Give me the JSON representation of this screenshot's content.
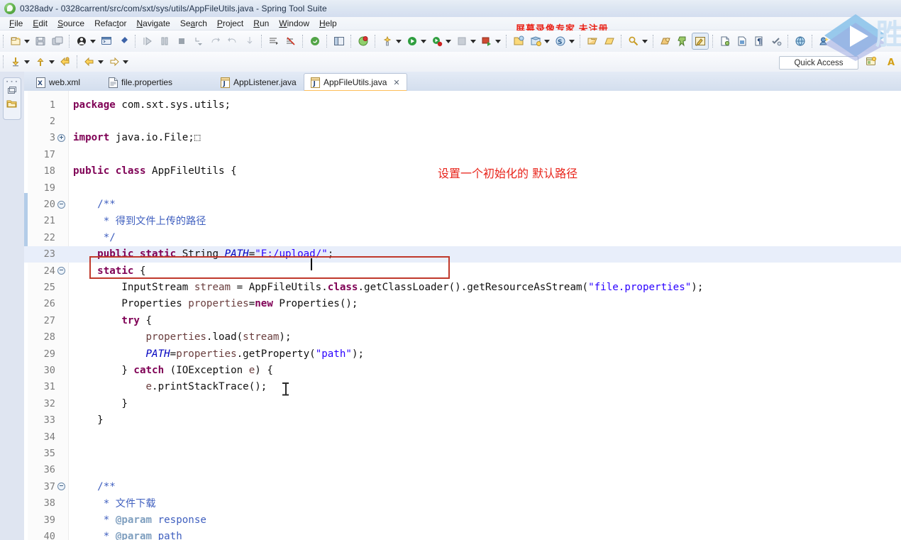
{
  "window": {
    "title": "0328adv - 0328carrent/src/com/sxt/sys/utils/AppFileUtils.java - Spring Tool Suite",
    "app_icon": "spring-leaf-icon"
  },
  "menubar": {
    "items": [
      {
        "label": "File",
        "mnemonic": "F"
      },
      {
        "label": "Edit",
        "mnemonic": "E"
      },
      {
        "label": "Source",
        "mnemonic": "S"
      },
      {
        "label": "Refactor",
        "mnemonic": "t"
      },
      {
        "label": "Navigate",
        "mnemonic": "N"
      },
      {
        "label": "Search",
        "mnemonic": "a"
      },
      {
        "label": "Project",
        "mnemonic": "P"
      },
      {
        "label": "Run",
        "mnemonic": "R"
      },
      {
        "label": "Window",
        "mnemonic": "W"
      },
      {
        "label": "Help",
        "mnemonic": "H"
      }
    ]
  },
  "watermark": {
    "recorder_text": "屏幕录像专家  未注册",
    "recorder_color": "#e8231a",
    "play_badge": "play-button-watermark",
    "edge_char": "胜"
  },
  "toolbar": {
    "row1": [
      {
        "name": "new-wizard-icon",
        "dropdown": true
      },
      {
        "name": "save-icon",
        "dropdown": false
      },
      {
        "name": "save-all-icon",
        "dropdown": false
      },
      {
        "name": "tomcat-server-icon",
        "dropdown": true
      },
      {
        "name": "console-icon",
        "dropdown": false
      },
      {
        "name": "pin-icon",
        "dropdown": false
      },
      {
        "name": "resume-icon",
        "dropdown": false
      },
      {
        "name": "suspend-icon",
        "dropdown": false
      },
      {
        "name": "terminate-icon",
        "dropdown": false
      },
      {
        "name": "step-into-icon",
        "dropdown": false
      },
      {
        "name": "step-over-icon",
        "dropdown": false
      },
      {
        "name": "step-return-icon",
        "dropdown": false
      },
      {
        "name": "drop-to-frame-icon",
        "dropdown": false
      },
      {
        "name": "next-annotation-icon",
        "dropdown": false
      },
      {
        "name": "skip-breakpoints-icon",
        "dropdown": false
      },
      {
        "name": "spring-boot-icon",
        "dropdown": false
      },
      {
        "name": "toggle-panel-icon",
        "dropdown": false
      },
      {
        "name": "error-marker-icon",
        "dropdown": false
      },
      {
        "name": "external-tools-icon",
        "dropdown": true
      },
      {
        "name": "run-icon",
        "dropdown": true
      },
      {
        "name": "debug-icon",
        "dropdown": true
      },
      {
        "name": "coverage-icon",
        "dropdown": true
      },
      {
        "name": "run-server-icon",
        "dropdown": true
      },
      {
        "name": "new-java-project-icon",
        "dropdown": false
      },
      {
        "name": "new-package-icon",
        "dropdown": true
      },
      {
        "name": "spring-bean-icon",
        "dropdown": true
      },
      {
        "name": "open-type-icon",
        "dropdown": false
      },
      {
        "name": "open-resource-icon",
        "dropdown": false
      },
      {
        "name": "search-ref-icon",
        "dropdown": true
      },
      {
        "name": "open-task-icon",
        "dropdown": false
      },
      {
        "name": "pin-editor-icon",
        "dropdown": false
      },
      {
        "name": "toggle-mark-occurrences-icon",
        "dropdown": false
      },
      {
        "name": "new-xml-file-icon",
        "dropdown": false
      },
      {
        "name": "new-jsp-icon",
        "dropdown": false
      },
      {
        "name": "paragraph-icon",
        "dropdown": false
      },
      {
        "name": "validate-icon",
        "dropdown": false
      },
      {
        "name": "web-browser-icon",
        "dropdown": false
      },
      {
        "name": "deploy-icon",
        "dropdown": false
      }
    ],
    "row2": [
      {
        "name": "previous-edit-icon",
        "dropdown": true
      },
      {
        "name": "next-edit-icon",
        "dropdown": true
      },
      {
        "name": "back-icon",
        "dropdown": false
      },
      {
        "name": "forward-icon",
        "dropdown": true
      },
      {
        "name": "forward-history-icon",
        "dropdown": true
      }
    ],
    "quick_access_label": "Quick Access",
    "perspective_icons": [
      "open-perspective-icon",
      "java-perspective-icon"
    ]
  },
  "left_rail": {
    "minimized_views": [
      "restore-icon",
      "package-explorer-icon"
    ]
  },
  "editor": {
    "tabs": [
      {
        "label": "web.xml",
        "icon": "xml-file-icon",
        "active": false,
        "closable": false
      },
      {
        "label": "file.properties",
        "icon": "properties-file-icon",
        "active": false,
        "closable": false
      },
      {
        "label": "AppListener.java",
        "icon": "java-file-icon",
        "active": false,
        "closable": false
      },
      {
        "label": "AppFileUtils.java",
        "icon": "java-file-icon",
        "active": true,
        "closable": true
      }
    ],
    "close_glyph": "✕",
    "highlighted_line": 23,
    "lines": [
      {
        "n": 1,
        "fold": "",
        "html": "<span class='kw'>package</span> com.sxt.sys.utils;"
      },
      {
        "n": 2,
        "fold": "",
        "html": ""
      },
      {
        "n": 3,
        "fold": "plus",
        "html": "<span class='kw'>import</span> java.io.File;<span class='pln'>⬚</span>"
      },
      {
        "n": 17,
        "fold": "",
        "html": ""
      },
      {
        "n": 18,
        "fold": "",
        "html": "<span class='kw'>public</span> <span class='kw'>class</span> AppFileUtils {"
      },
      {
        "n": 19,
        "fold": "",
        "html": ""
      },
      {
        "n": 20,
        "fold": "minus",
        "html": "    <span class='jdoc'>/**</span>"
      },
      {
        "n": 21,
        "fold": "",
        "html": "     <span class='jdoc'>* 得到文件上传的路径</span>"
      },
      {
        "n": 22,
        "fold": "",
        "html": "     <span class='jdoc'>*/</span>"
      },
      {
        "n": 23,
        "fold": "",
        "html": "    <span class='kw'>public</span> <span class='kw'>static</span> String <span class='fld'>PATH</span>=<span class='str'>\"E:/upload/\"</span>;"
      },
      {
        "n": 24,
        "fold": "minus",
        "html": "    <span class='kw'>static</span> {"
      },
      {
        "n": 25,
        "fold": "",
        "html": "        InputStream <span class='loc'>stream</span> = AppFileUtils.<span class='kw'>class</span>.getClassLoader().getResourceAsStream(<span class='str'>\"file.properties\"</span>);"
      },
      {
        "n": 26,
        "fold": "",
        "html": "        Properties <span class='loc'>properties</span>=<span class='kw'>new</span> Properties();"
      },
      {
        "n": 27,
        "fold": "",
        "html": "        <span class='kw'>try</span> {"
      },
      {
        "n": 28,
        "fold": "",
        "html": "            <span class='loc'>properties</span>.load(<span class='loc'>stream</span>);"
      },
      {
        "n": 29,
        "fold": "",
        "html": "            <span class='fld'>PATH</span>=<span class='loc'>properties</span>.getProperty(<span class='str'>\"path\"</span>);"
      },
      {
        "n": 30,
        "fold": "",
        "html": "        } <span class='kw'>catch</span> (IOException <span class='loc'>e</span>) {"
      },
      {
        "n": 31,
        "fold": "",
        "html": "            <span class='loc'>e</span>.printStackTrace();"
      },
      {
        "n": 32,
        "fold": "",
        "html": "        }"
      },
      {
        "n": 33,
        "fold": "",
        "html": "    }"
      },
      {
        "n": 34,
        "fold": "",
        "html": ""
      },
      {
        "n": 35,
        "fold": "",
        "html": ""
      },
      {
        "n": 36,
        "fold": "",
        "html": ""
      },
      {
        "n": 37,
        "fold": "minus",
        "html": "    <span class='jdoc'>/**</span>"
      },
      {
        "n": 38,
        "fold": "",
        "html": "     <span class='jdoc'>* 文件下载</span>"
      },
      {
        "n": 39,
        "fold": "",
        "html": "     <span class='jdoc'>* </span><span class='jtag'>@param</span><span class='jdoc'> response</span>"
      },
      {
        "n": 40,
        "fold": "",
        "html": "     <span class='jdoc'>* </span><span class='jtag'>@param</span><span class='jdoc'> path</span>"
      }
    ]
  },
  "annotation": {
    "note_text": "设置一个初始化的  默认路径",
    "box_color": "#c0392b",
    "note_color": "#e8241b"
  }
}
